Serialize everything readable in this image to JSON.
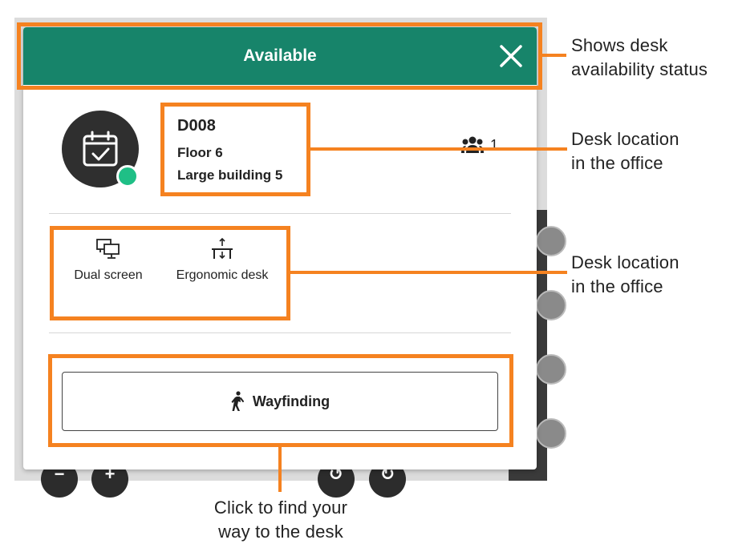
{
  "header": {
    "status_title": "Available",
    "color": "#17846a"
  },
  "desk": {
    "id": "D008",
    "floor": "Floor 6",
    "building": "Large building 5",
    "occupancy": "1"
  },
  "features": [
    {
      "label": "Dual screen",
      "icon": "dual-screen-icon"
    },
    {
      "label": "Ergonomic desk",
      "icon": "ergonomic-desk-icon"
    }
  ],
  "wayfinding": {
    "label": "Wayfinding",
    "icon": "walking-person-icon"
  },
  "map_controls": {
    "zoom_out": "−",
    "zoom_in": "+",
    "rotate_left": "↺",
    "rotate_right": "↻"
  },
  "annotations": {
    "status": [
      "Shows desk",
      "availability status"
    ],
    "location": [
      "Desk location",
      "in the office"
    ],
    "features": [
      "Desk location",
      "in the office"
    ],
    "wayfinding": [
      "Click to find your",
      "way to the desk"
    ],
    "accent_color": "#f58220"
  }
}
